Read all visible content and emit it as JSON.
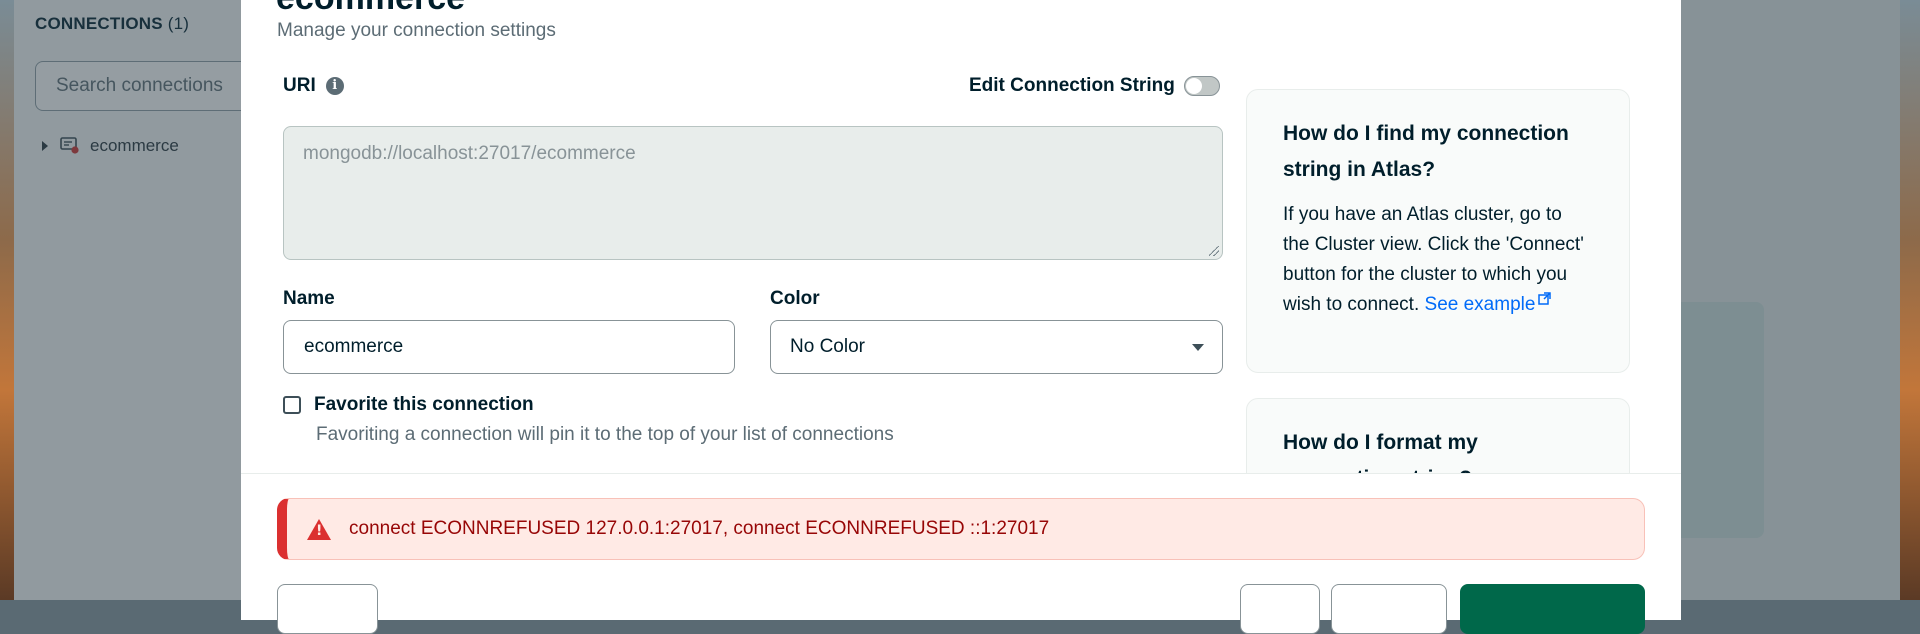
{
  "sidebar": {
    "connections_label": "CONNECTIONS",
    "connections_count": "(1)",
    "search_placeholder": "Search connections",
    "items": [
      {
        "label": "ecommerce",
        "icon": "server-error-icon"
      }
    ]
  },
  "modal": {
    "title": "ecommerce",
    "subtitle": "Manage your connection settings",
    "uri_label": "URI",
    "edit_connection_string_label": "Edit Connection String",
    "edit_connection_string_enabled": false,
    "uri_value": "mongodb://localhost:27017/ecommerce",
    "name_label": "Name",
    "name_value": "ecommerce",
    "color_label": "Color",
    "color_value": "No Color",
    "favorite_label": "Favorite this connection",
    "favorite_checked": false,
    "favorite_description": "Favoriting a connection will pin it to the top of your list of connections",
    "help": [
      {
        "title": "How do I find my connection string in Atlas?",
        "body": "If you have an Atlas cluster, go to the Cluster view. Click the 'Connect' button for the cluster to which you wish to connect.",
        "link": "See example"
      },
      {
        "title": "How do I format my connection string?"
      }
    ],
    "error_message": "connect ECONNREFUSED 127.0.0.1:27017, connect ECONNREFUSED ::1:27017"
  },
  "colors": {
    "error": "#DB3030",
    "link": "#016BF8",
    "primary": "#00684A"
  }
}
